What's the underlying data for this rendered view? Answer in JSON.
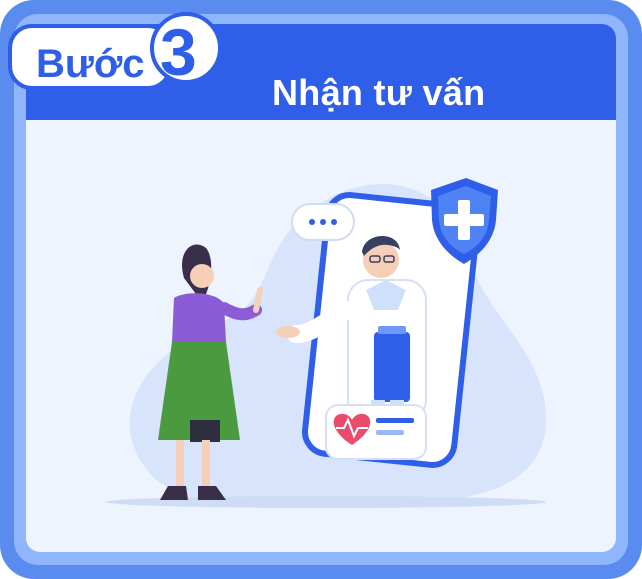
{
  "step": {
    "word": "Bước",
    "number": "3",
    "title": "Nhận tư vấn"
  },
  "icons": [
    "chat-bubble-icon",
    "shield-plus-icon",
    "heart-pulse-icon",
    "clipboard-icon"
  ],
  "colors": {
    "frame_outer": "#5a8cf0",
    "frame_inner": "#8fb6fb",
    "header": "#2f5ee8",
    "panel": "#eef4fd",
    "accent_purple": "#8b5cd6",
    "accent_green": "#4c9a3f",
    "heart": "#e94d6b"
  }
}
